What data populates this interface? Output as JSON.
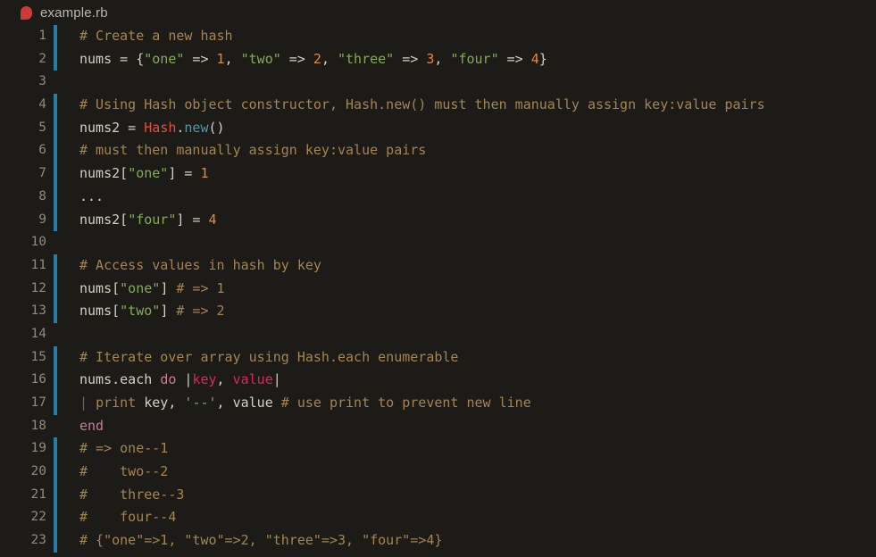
{
  "titlebar": {
    "icon": "ruby-file-icon",
    "filename": "example.rb"
  },
  "editor": {
    "language": "ruby",
    "accent_color": "#2a7ca8",
    "background_color": "#1d1b17",
    "lines": [
      {
        "n": "1",
        "bar": true,
        "tokens": [
          {
            "t": "comment",
            "v": "# Create a new hash"
          }
        ]
      },
      {
        "n": "2",
        "bar": true,
        "tokens": [
          {
            "t": "plain",
            "v": "nums = {"
          },
          {
            "t": "string",
            "v": "\"one\""
          },
          {
            "t": "plain",
            "v": " => "
          },
          {
            "t": "number",
            "v": "1"
          },
          {
            "t": "plain",
            "v": ", "
          },
          {
            "t": "string",
            "v": "\"two\""
          },
          {
            "t": "plain",
            "v": " => "
          },
          {
            "t": "number",
            "v": "2"
          },
          {
            "t": "plain",
            "v": ", "
          },
          {
            "t": "string",
            "v": "\"three\""
          },
          {
            "t": "plain",
            "v": " => "
          },
          {
            "t": "number",
            "v": "3"
          },
          {
            "t": "plain",
            "v": ", "
          },
          {
            "t": "string",
            "v": "\"four\""
          },
          {
            "t": "plain",
            "v": " => "
          },
          {
            "t": "number",
            "v": "4"
          },
          {
            "t": "plain",
            "v": "}"
          }
        ]
      },
      {
        "n": "3",
        "bar": false,
        "tokens": []
      },
      {
        "n": "4",
        "bar": true,
        "tokens": [
          {
            "t": "comment",
            "v": "# Using Hash object constructor, Hash.new() must then manually assign key:value pairs"
          }
        ]
      },
      {
        "n": "5",
        "bar": true,
        "tokens": [
          {
            "t": "plain",
            "v": "nums2 = "
          },
          {
            "t": "const",
            "v": "Hash"
          },
          {
            "t": "plain",
            "v": "."
          },
          {
            "t": "method",
            "v": "new"
          },
          {
            "t": "plain",
            "v": "()"
          }
        ]
      },
      {
        "n": "6",
        "bar": true,
        "tokens": [
          {
            "t": "comment",
            "v": "# must then manually assign key:value pairs"
          }
        ]
      },
      {
        "n": "7",
        "bar": true,
        "tokens": [
          {
            "t": "plain",
            "v": "nums2["
          },
          {
            "t": "string",
            "v": "\"one\""
          },
          {
            "t": "plain",
            "v": "] = "
          },
          {
            "t": "number",
            "v": "1"
          }
        ]
      },
      {
        "n": "8",
        "bar": true,
        "tokens": [
          {
            "t": "plain",
            "v": "..."
          }
        ]
      },
      {
        "n": "9",
        "bar": true,
        "tokens": [
          {
            "t": "plain",
            "v": "nums2["
          },
          {
            "t": "string",
            "v": "\"four\""
          },
          {
            "t": "plain",
            "v": "] = "
          },
          {
            "t": "number",
            "v": "4"
          }
        ]
      },
      {
        "n": "10",
        "bar": false,
        "tokens": []
      },
      {
        "n": "11",
        "bar": true,
        "tokens": [
          {
            "t": "comment",
            "v": "# Access values in hash by key"
          }
        ]
      },
      {
        "n": "12",
        "bar": true,
        "tokens": [
          {
            "t": "plain",
            "v": "nums["
          },
          {
            "t": "string",
            "v": "\"one\""
          },
          {
            "t": "plain",
            "v": "] "
          },
          {
            "t": "comment",
            "v": "# => 1"
          }
        ]
      },
      {
        "n": "13",
        "bar": true,
        "tokens": [
          {
            "t": "plain",
            "v": "nums["
          },
          {
            "t": "string",
            "v": "\"two\""
          },
          {
            "t": "plain",
            "v": "] "
          },
          {
            "t": "comment",
            "v": "# => 2"
          }
        ]
      },
      {
        "n": "14",
        "bar": false,
        "tokens": []
      },
      {
        "n": "15",
        "bar": true,
        "tokens": [
          {
            "t": "comment",
            "v": "# Iterate over array using Hash.each enumerable"
          }
        ]
      },
      {
        "n": "16",
        "bar": true,
        "tokens": [
          {
            "t": "plain",
            "v": "nums.each "
          },
          {
            "t": "keyword",
            "v": "do"
          },
          {
            "t": "plain",
            "v": " |"
          },
          {
            "t": "param",
            "v": "key"
          },
          {
            "t": "plain",
            "v": ", "
          },
          {
            "t": "param",
            "v": "value"
          },
          {
            "t": "plain",
            "v": "|"
          }
        ]
      },
      {
        "n": "17",
        "bar": true,
        "tokens": [
          {
            "t": "indent",
            "v": "|"
          },
          {
            "t": "plain",
            "v": " "
          },
          {
            "t": "func",
            "v": "print"
          },
          {
            "t": "plain",
            "v": " key, "
          },
          {
            "t": "string",
            "v": "'--'"
          },
          {
            "t": "plain",
            "v": ", value "
          },
          {
            "t": "comment",
            "v": "# use print to prevent new line"
          }
        ]
      },
      {
        "n": "18",
        "bar": false,
        "tokens": [
          {
            "t": "keyword",
            "v": "end"
          }
        ]
      },
      {
        "n": "19",
        "bar": true,
        "tokens": [
          {
            "t": "comment",
            "v": "# => one--1"
          }
        ]
      },
      {
        "n": "20",
        "bar": true,
        "tokens": [
          {
            "t": "comment",
            "v": "#    two--2"
          }
        ]
      },
      {
        "n": "21",
        "bar": true,
        "tokens": [
          {
            "t": "comment",
            "v": "#    three--3"
          }
        ]
      },
      {
        "n": "22",
        "bar": true,
        "tokens": [
          {
            "t": "comment",
            "v": "#    four--4"
          }
        ]
      },
      {
        "n": "23",
        "bar": true,
        "tokens": [
          {
            "t": "comment",
            "v": "# {\"one\"=>1, \"two\"=>2, \"three\"=>3, \"four\"=>4}"
          }
        ]
      }
    ]
  }
}
